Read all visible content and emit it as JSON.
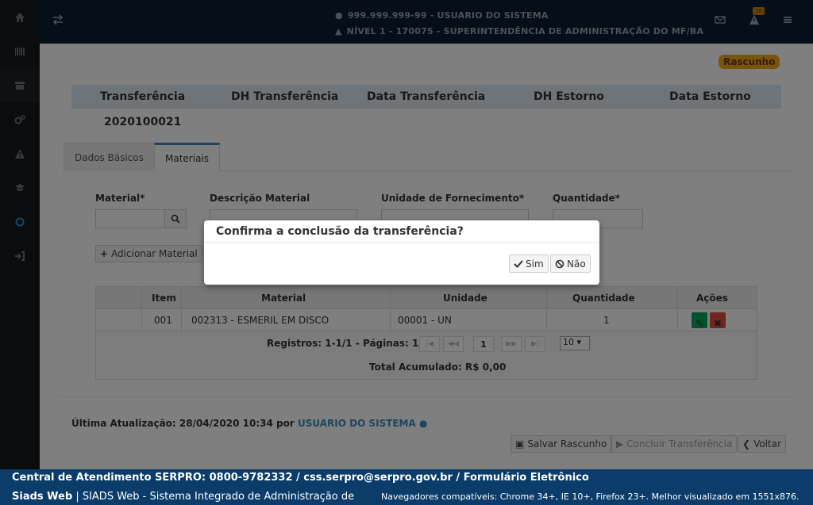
{
  "header": {
    "user_line": "999.999.999-99 - USUARIO DO SISTEMA",
    "unit_line": "NÍVEL 1 - 170075 - SUPERINTENDÊNCIA DE ADMINISTRAÇÃO DO MF/BA",
    "alert_count": "10"
  },
  "sidebar": {
    "items": [
      "home-icon",
      "barcode-icon",
      "archive-icon",
      "cogs-icon",
      "warning-icon",
      "graduation-cap-icon",
      "circle-icon",
      "sign-out-icon"
    ]
  },
  "page": {
    "status_badge": "Rascunho",
    "summary_headers": [
      "Transferência",
      "DH Transferência",
      "Data Transferência",
      "DH Estorno",
      "Data Estorno"
    ],
    "summary_value": "2020100021",
    "tabs": [
      "Dados Básicos",
      "Materiais"
    ],
    "active_tab": "Materiais"
  },
  "form": {
    "material_label": "Material*",
    "descricao_label": "Descrição Material",
    "unidade_label": "Unidade de Fornecimento*",
    "quantidade_label": "Quantidade*",
    "add_button": "Adicionar Material"
  },
  "grid": {
    "columns": [
      "Item",
      "Material",
      "Unidade",
      "Quantidade",
      "Ações"
    ],
    "rows": [
      {
        "item": "001",
        "material": "002313 - ESMERIL EM DISCO",
        "unidade": "00001 - UN",
        "quantidade": "1"
      }
    ],
    "pager_text": "Registros: 1-1/1 - Páginas: 1/1",
    "current_page": "1",
    "page_size": "10",
    "total": "Total Acumulado: R$ 0,00"
  },
  "footer_info": {
    "last_update": "Última Atualização: 28/04/2020 10:34 por",
    "user": "USUARIO DO SISTEMA",
    "save_button": "Salvar Rascunho",
    "conclude_button": "Concluir Transferência",
    "back_button": "Voltar"
  },
  "modal": {
    "title": "Confirma a conclusão da transferência?",
    "yes": "Sim",
    "no": "Não"
  },
  "footer": {
    "line1": "Central de Atendimento SERPRO: 0800-9782332 / css.serpro@serpro.gov.br / Formulário Eletrônico",
    "brand": "Siads Web",
    "line2": "| SIADS Web - Sistema Integrado de Administração de",
    "browsers": "Navegadores compatíveis: Chrome 34+, IE 10+, Firefox 23+. Melhor visualizado em 1551x876."
  }
}
